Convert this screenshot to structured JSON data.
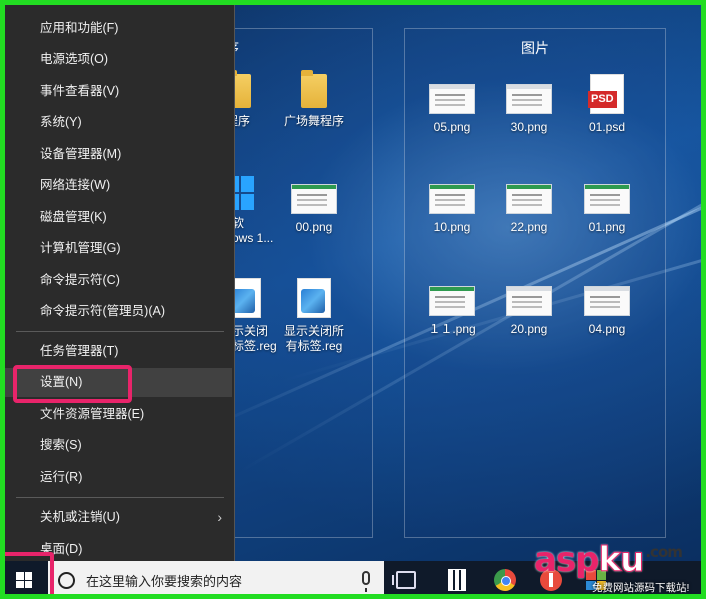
{
  "desktop": {
    "groups": [
      {
        "title": "程序"
      },
      {
        "title": "图片"
      }
    ],
    "left_files": [
      {
        "label": "程序",
        "icon": "folder-icon"
      },
      {
        "label": "广场舞程序",
        "icon": "folder-icon"
      },
      {
        "label": "软\nows 1...",
        "icon": "windows-logo-icon"
      },
      {
        "label": "00.png",
        "icon": "image-thumbnail-icon"
      },
      {
        "label": "示关闭\n标签.reg",
        "icon": "registry-file-icon"
      },
      {
        "label": "显示关闭所\n有标签.reg",
        "icon": "registry-file-icon"
      }
    ],
    "right_files": [
      {
        "label": "05.png"
      },
      {
        "label": "30.png"
      },
      {
        "label": "01.psd",
        "badge": "PSD"
      },
      {
        "label": "10.png"
      },
      {
        "label": "22.png"
      },
      {
        "label": "01.png"
      },
      {
        "label": "１１.png"
      },
      {
        "label": "20.png"
      },
      {
        "label": "04.png"
      }
    ]
  },
  "context_menu": {
    "items": [
      {
        "label": "应用和功能(F)"
      },
      {
        "label": "电源选项(O)"
      },
      {
        "label": "事件查看器(V)"
      },
      {
        "label": "系统(Y)"
      },
      {
        "label": "设备管理器(M)"
      },
      {
        "label": "网络连接(W)"
      },
      {
        "label": "磁盘管理(K)"
      },
      {
        "label": "计算机管理(G)"
      },
      {
        "label": "命令提示符(C)"
      },
      {
        "label": "命令提示符(管理员)(A)"
      },
      {
        "label": "任务管理器(T)"
      },
      {
        "label": "设置(N)"
      },
      {
        "label": "文件资源管理器(E)"
      },
      {
        "label": "搜索(S)"
      },
      {
        "label": "运行(R)"
      },
      {
        "label": "关机或注销(U)"
      },
      {
        "label": "桌面(D)"
      }
    ],
    "highlighted": "设置(N)"
  },
  "taskbar": {
    "search_placeholder": "在这里输入你要搜索的内容",
    "icons": [
      "task-view-icon",
      "calculator-icon",
      "browser-icon",
      "red-app-icon",
      "windows-app-icon"
    ]
  },
  "watermark": {
    "brand_a": "asp",
    "brand_b": "ku",
    "brand_suffix": ".com",
    "tagline": "免费网站源码下载站!"
  },
  "colors": {
    "highlight": "#e8246a",
    "frame": "#22dd22",
    "menu_bg": "#2b2b2b"
  }
}
